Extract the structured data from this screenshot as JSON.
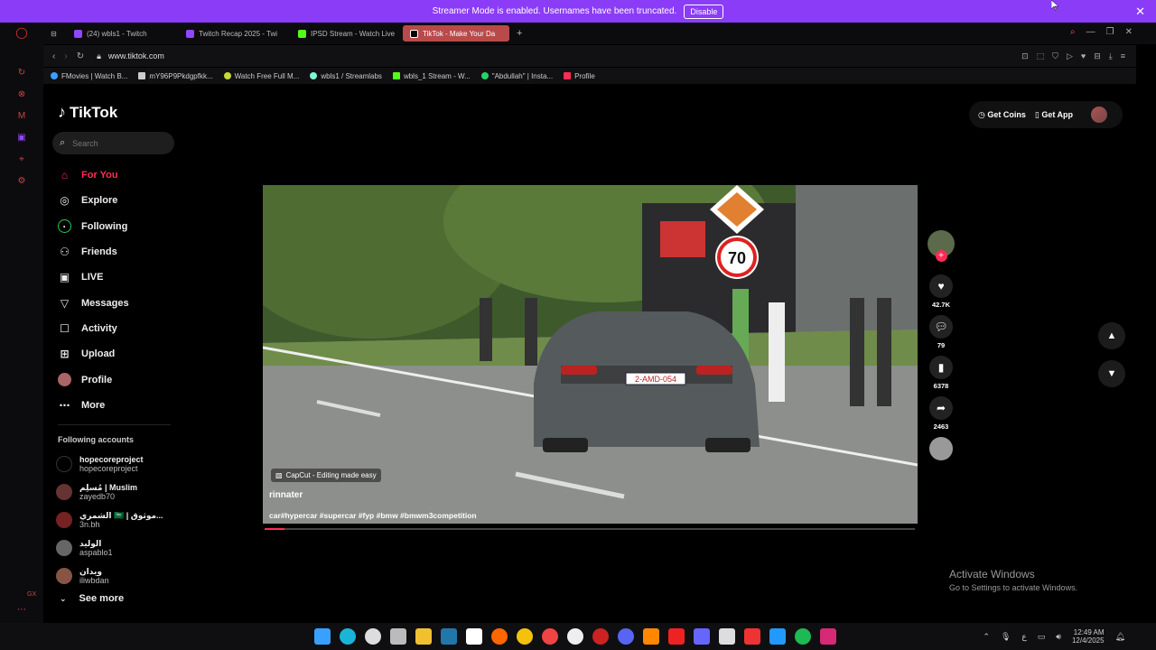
{
  "banner": {
    "message": "Streamer Mode is enabled. Usernames have been truncated.",
    "button": "Disable"
  },
  "tabs": [
    {
      "label": "(24) wbls1 - Twitch",
      "color": "#9146ff"
    },
    {
      "label": "Twitch Recap 2025 - Twi",
      "color": "#9146ff"
    },
    {
      "label": "IPSD Stream - Watch Live",
      "color": "#53fc18"
    },
    {
      "label": "TikTok - Make Your Da",
      "color": "#ffffff",
      "active": true
    }
  ],
  "address": {
    "url": "www.tiktok.com"
  },
  "bookmarks": [
    {
      "label": "FMovies | Watch B...",
      "color": "#3aa0ff"
    },
    {
      "label": "mY96P9Pkdgpfkk...",
      "color": "#cccccc"
    },
    {
      "label": "Watch Free Full M...",
      "color": "#c6d93b"
    },
    {
      "label": "wbls1 / Streamlabs",
      "color": "#80f5d2"
    },
    {
      "label": "wbls_1 Stream - W...",
      "color": "#53fc18"
    },
    {
      "label": "\"Abdullah\" | Insta...",
      "color": "#25d366"
    },
    {
      "label": "Profile",
      "color": "#fe2c55"
    }
  ],
  "tiktok": {
    "logo": "TikTok",
    "search_placeholder": "Search",
    "menu": [
      {
        "label": "For You",
        "icon": "home-icon",
        "active": true
      },
      {
        "label": "Explore",
        "icon": "compass-icon"
      },
      {
        "label": "Following",
        "icon": "following-icon"
      },
      {
        "label": "Friends",
        "icon": "friends-icon"
      },
      {
        "label": "LIVE",
        "icon": "live-icon"
      },
      {
        "label": "Messages",
        "icon": "messages-icon"
      },
      {
        "label": "Activity",
        "icon": "activity-icon"
      },
      {
        "label": "Upload",
        "icon": "upload-icon"
      },
      {
        "label": "Profile",
        "icon": "profile-icon"
      },
      {
        "label": "More",
        "icon": "more-icon"
      }
    ],
    "following_title": "Following accounts",
    "accounts": [
      {
        "name": "hopecoreproject",
        "handle": "hopecoreproject"
      },
      {
        "name": "مُسلِم | Muslim",
        "handle": "zayedb70"
      },
      {
        "name": "الشمري 🇸🇦 | موثوق...",
        "handle": "3n.bh"
      },
      {
        "name": "الوليد",
        "handle": "aspablo1"
      },
      {
        "name": "ويدان",
        "handle": "iliwbdan"
      }
    ],
    "see_more": "See more",
    "top_actions": {
      "coins": "Get Coins",
      "app": "Get App"
    },
    "video": {
      "capcut": "CapCut - Editing made easy",
      "author": "rinnater",
      "caption": "car#hypercar #supercar #fyp #bmw #bmwm3competition",
      "plate": "2-AMD-054",
      "speed_sign": "70",
      "progress": 0.03
    },
    "counts": {
      "likes": "42.7K",
      "comments": "79",
      "saves": "6378",
      "shares": "2463"
    }
  },
  "watermark": {
    "line1": "Activate Windows",
    "line2": "Go to Settings to activate Windows."
  },
  "taskbar": {
    "time": "12:49 AM",
    "date": "12/4/2025"
  },
  "sidebar_label": "GX"
}
